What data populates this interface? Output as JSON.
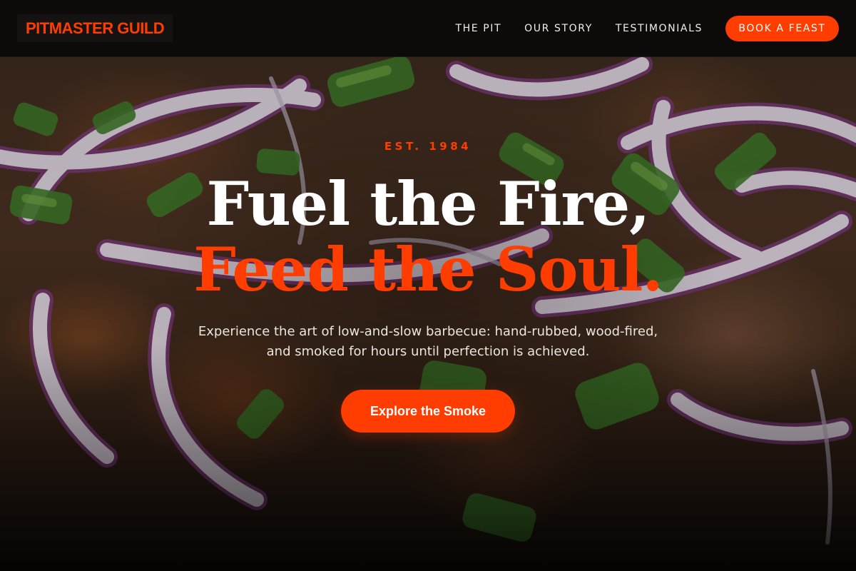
{
  "brand": {
    "name": "PITMASTER GUILD",
    "accent_color": "#ff3d00"
  },
  "nav": {
    "links": [
      "THE PIT",
      "OUR STORY",
      "TESTIMONIALS"
    ],
    "cta_label": "BOOK A FEAST"
  },
  "hero": {
    "eyebrow": "EST. 1984",
    "headline_line1": "Fuel the Fire,",
    "headline_line2": "Feed the Soul.",
    "subtext": "Experience the art of low-and-slow barbecue: hand-rubbed, wood-fired, and smoked for hours until perfection is achieved.",
    "cta_label": "Explore the Smoke",
    "background_image": "barbecue-photo"
  }
}
